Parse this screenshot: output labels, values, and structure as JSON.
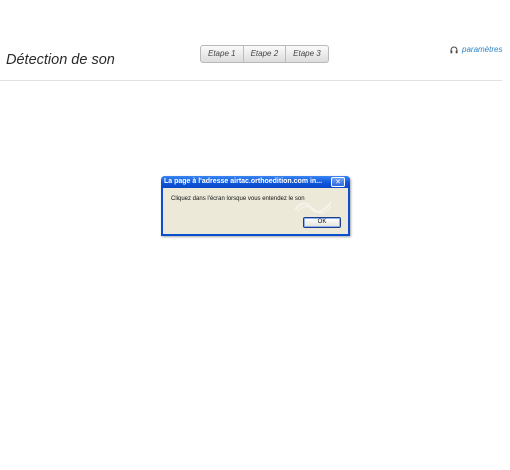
{
  "header": {
    "title": "Détection de son",
    "steps": [
      {
        "label": "Etape 1"
      },
      {
        "label": "Etape 2"
      },
      {
        "label": "Etape 3"
      }
    ],
    "settings": {
      "label": "paramètres",
      "icon": "headphones-icon"
    }
  },
  "dialog": {
    "title": "La page à l'adresse airtac.orthoedition.com in...",
    "message": "Cliquez dans l'écran lorsque vous entendez le son",
    "ok_label": "OK",
    "close_icon": "close-icon",
    "colors": {
      "titlebar": "#0f56db",
      "client": "#ece9d8"
    }
  },
  "colors": {
    "accent": "#2a82c4"
  }
}
